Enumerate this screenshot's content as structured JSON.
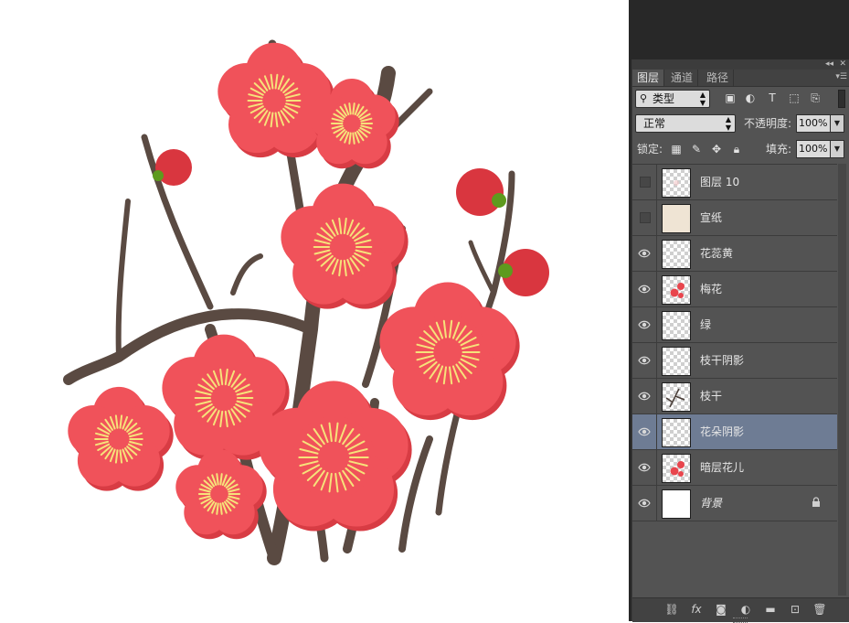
{
  "panel": {
    "tabs": [
      {
        "label": "图层",
        "active": true
      },
      {
        "label": "通道",
        "active": false
      },
      {
        "label": "路径",
        "active": false
      }
    ],
    "filter_kind": "类型",
    "blend_mode": "正常",
    "opacity_label": "不透明度:",
    "opacity_value": "100%",
    "lock_label": "锁定:",
    "fill_label": "填充:",
    "fill_value": "100%",
    "filter_icons": [
      "image-filter-icon",
      "adjustment-filter-icon",
      "type-filter-icon",
      "shape-filter-icon",
      "smart-object-filter-icon"
    ],
    "lock_icons": [
      "lock-transparent-pixels-icon",
      "lock-image-pixels-icon",
      "lock-position-icon",
      "lock-all-icon"
    ],
    "bottom_icons": [
      "link-layers-icon",
      "fx-icon",
      "add-mask-icon",
      "new-adjustment-layer-icon",
      "new-group-icon",
      "new-layer-icon",
      "delete-layer-icon"
    ]
  },
  "layers": [
    {
      "name": "图层 10",
      "visible": false,
      "thumb": "checker-flower",
      "selected": false,
      "italic": false,
      "locked": false
    },
    {
      "name": "宣纸",
      "visible": false,
      "thumb": "paper",
      "selected": false,
      "italic": false,
      "locked": false
    },
    {
      "name": "花蕊黄",
      "visible": true,
      "thumb": "checker",
      "selected": false,
      "italic": false,
      "locked": false
    },
    {
      "name": "梅花",
      "visible": true,
      "thumb": "checker-red",
      "selected": false,
      "italic": false,
      "locked": false
    },
    {
      "name": "绿",
      "visible": true,
      "thumb": "checker",
      "selected": false,
      "italic": false,
      "locked": false
    },
    {
      "name": "枝干阴影",
      "visible": true,
      "thumb": "checker",
      "selected": false,
      "italic": false,
      "locked": false
    },
    {
      "name": "枝干",
      "visible": true,
      "thumb": "checker-branch",
      "selected": false,
      "italic": false,
      "locked": false
    },
    {
      "name": "花朵阴影",
      "visible": true,
      "thumb": "checker",
      "selected": true,
      "italic": false,
      "locked": false
    },
    {
      "name": "暗层花儿",
      "visible": true,
      "thumb": "checker-red",
      "selected": false,
      "italic": false,
      "locked": false
    },
    {
      "name": "背景",
      "visible": true,
      "thumb": "white",
      "selected": false,
      "italic": true,
      "locked": true
    }
  ],
  "colors": {
    "petal": "#f0525a",
    "petal_shadow": "#d83c44",
    "bud": "#d9363f",
    "stamen": "#f6e27a",
    "branch": "#5a4a42",
    "leaf": "#5e9a1e",
    "panel_bg": "#535353",
    "selected_row": "#6e7c94"
  }
}
